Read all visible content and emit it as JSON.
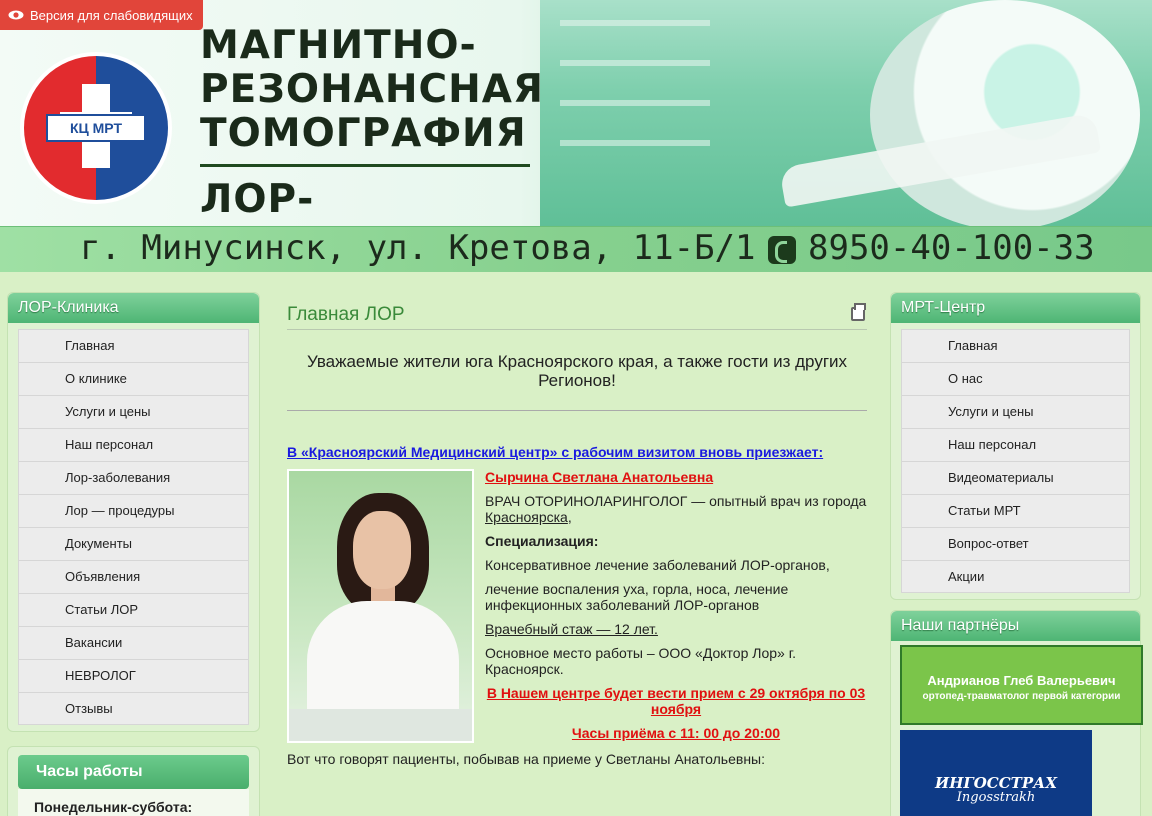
{
  "accessibility": {
    "label": "Версия для слабовидящих"
  },
  "logo": {
    "text": "КЦ МРТ"
  },
  "header": {
    "title_line1": "МАГНИТНО-",
    "title_line2": "РЕЗОНАНСНАЯ",
    "title_line3": "ТОМОГРАФИЯ",
    "subtitle": "ЛОР-КЛИНИКА",
    "address": "г. Минусинск, ул. Кретова, 11-Б/1",
    "phone": "8950-40-100-33"
  },
  "left_menu": {
    "title": "ЛОР-Клиника",
    "items": [
      "Главная",
      "О клинике",
      "Услуги и цены",
      "Наш персонал",
      "Лор-заболевания",
      "Лор — процедуры",
      "Документы",
      "Объявления",
      "Статьи ЛОР",
      "Вакансии",
      "НЕВРОЛОГ",
      "Отзывы"
    ]
  },
  "hours": {
    "title": "Часы работы",
    "line1": "Понедельник-суббота:"
  },
  "main": {
    "title": "Главная ЛОР",
    "intro": "Уважаемые жители юга Красноярского края, а также гости из других Регионов!",
    "lead": "В «Красноярский Медицинский центр» с рабочим визитом вновь приезжает:",
    "doctor_name": "Сырчина Светлана Анатольевна",
    "role_text": "ВРАЧ ОТОРИНОЛАРИНГОЛОГ — опытный врач из города ",
    "city_link": "Красноярска",
    "role_end": ",",
    "spec_title": "Специализация:",
    "spec1": "Консервативное лечение заболеваний ЛОР-органов,",
    "spec2": "лечение воспаления уха, горла, носа, лечение инфекционных заболеваний ЛОР-органов",
    "experience": "Врачебный стаж — 12 лет.",
    "workplace": "Основное место работы – ООО «Доктор Лор» г. Красноярск.",
    "reception_dates": "В Нашем центре будет вести прием с 29 октября по 03 ноября",
    "reception_hours": "Часы приёма с 11: 00 до 20:00",
    "patients_say": "Вот что говорят  пациенты, побывав на приеме у Светланы Анатольевны:"
  },
  "right_menu": {
    "title": "МРТ-Центр",
    "items": [
      "Главная",
      "О нас",
      "Услуги и цены",
      "Наш персонал",
      "Видеоматериалы",
      "Статьи МРТ",
      "Вопрос-ответ",
      "Акции"
    ]
  },
  "partners": {
    "title": "Наши партнёры",
    "p1_name": "Андрианов Глеб Валерьевич",
    "p1_sub": "ортопед-травматолог первой категории",
    "p2_name": "ИНГОССТРАХ",
    "p2_sub": "Ingosstrakh"
  },
  "colors": {
    "accent_green": "#4eb574",
    "alert_red": "#e01010",
    "link_blue": "#1a1adf",
    "page_bg": "#d9f0c6"
  }
}
